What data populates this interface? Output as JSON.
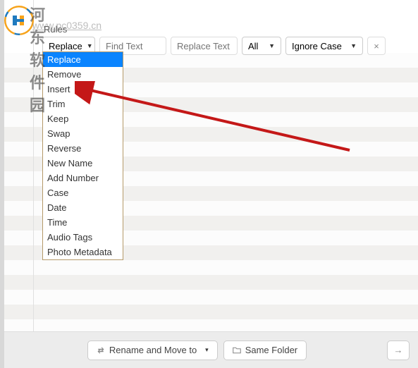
{
  "watermark": {
    "text": "河东软件园",
    "url": "www.pc0359.cn"
  },
  "header": {
    "rules_label": "Rules"
  },
  "controls": {
    "action_select": "Replace",
    "find_placeholder": "Find Text",
    "replace_placeholder": "Replace Text",
    "scope_select": "All",
    "case_select": "Ignore Case",
    "close_label": "×"
  },
  "dropdown": {
    "items": [
      "Replace",
      "Remove",
      "Insert",
      "Trim",
      "Keep",
      "Swap",
      "Reverse",
      "New Name",
      "Add Number",
      "Case",
      "Date",
      "Time",
      "Audio Tags",
      "Photo Metadata"
    ],
    "selected_index": 0
  },
  "footer": {
    "rename_button": "Rename and Move to",
    "folder_button": "Same Folder",
    "go_label": "→"
  }
}
